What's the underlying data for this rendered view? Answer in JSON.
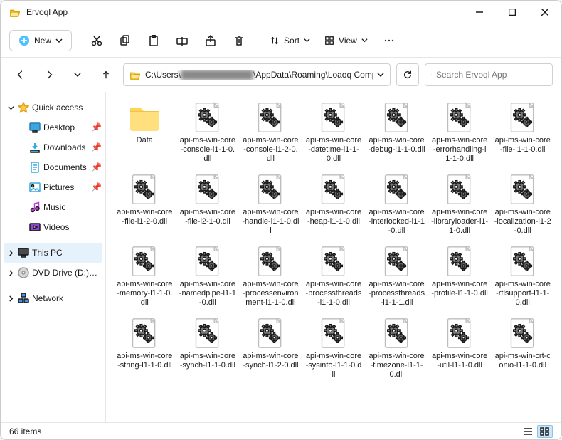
{
  "title": "Ervoql App",
  "toolbar": {
    "new": "New",
    "sort": "Sort",
    "view": "View"
  },
  "address": {
    "prefix": "C:\\Users\\",
    "blurred": "████████████",
    "suffix": "\\AppData\\Roaming\\Loaoq Comp Sols\\Ervoql App"
  },
  "search_placeholder": "Search Ervoql App",
  "sidebar": {
    "quick": "Quick access",
    "items": [
      "Desktop",
      "Downloads",
      "Documents",
      "Pictures",
      "Music",
      "Videos"
    ],
    "thispc": "This PC",
    "dvd": "DVD Drive (D:) CCCC",
    "network": "Network"
  },
  "files": [
    {
      "name": "Data",
      "type": "folder"
    },
    {
      "name": "api-ms-win-core-console-l1-1-0.dll",
      "type": "dll"
    },
    {
      "name": "api-ms-win-core-console-l1-2-0.dll",
      "type": "dll"
    },
    {
      "name": "api-ms-win-core-datetime-l1-1-0.dll",
      "type": "dll"
    },
    {
      "name": "api-ms-win-core-debug-l1-1-0.dll",
      "type": "dll"
    },
    {
      "name": "api-ms-win-core-errorhandling-l1-1-0.dll",
      "type": "dll"
    },
    {
      "name": "api-ms-win-core-file-l1-1-0.dll",
      "type": "dll"
    },
    {
      "name": "api-ms-win-core-file-l1-2-0.dll",
      "type": "dll"
    },
    {
      "name": "api-ms-win-core-file-l2-1-0.dll",
      "type": "dll"
    },
    {
      "name": "api-ms-win-core-handle-l1-1-0.dll",
      "type": "dll"
    },
    {
      "name": "api-ms-win-core-heap-l1-1-0.dll",
      "type": "dll"
    },
    {
      "name": "api-ms-win-core-interlocked-l1-1-0.dll",
      "type": "dll"
    },
    {
      "name": "api-ms-win-core-libraryloader-l1-1-0.dll",
      "type": "dll"
    },
    {
      "name": "api-ms-win-core-localization-l1-2-0.dll",
      "type": "dll"
    },
    {
      "name": "api-ms-win-core-memory-l1-1-0.dll",
      "type": "dll"
    },
    {
      "name": "api-ms-win-core-namedpipe-l1-1-0.dll",
      "type": "dll"
    },
    {
      "name": "api-ms-win-core-processenvironment-l1-1-0.dll",
      "type": "dll"
    },
    {
      "name": "api-ms-win-core-processthreads-l1-1-0.dll",
      "type": "dll"
    },
    {
      "name": "api-ms-win-core-processthreads-l1-1-1.dll",
      "type": "dll"
    },
    {
      "name": "api-ms-win-core-profile-l1-1-0.dll",
      "type": "dll"
    },
    {
      "name": "api-ms-win-core-rtlsupport-l1-1-0.dll",
      "type": "dll"
    },
    {
      "name": "api-ms-win-core-string-l1-1-0.dll",
      "type": "dll"
    },
    {
      "name": "api-ms-win-core-synch-l1-1-0.dll",
      "type": "dll"
    },
    {
      "name": "api-ms-win-core-synch-l1-2-0.dll",
      "type": "dll"
    },
    {
      "name": "api-ms-win-core-sysinfo-l1-1-0.dll",
      "type": "dll"
    },
    {
      "name": "api-ms-win-core-timezone-l1-1-0.dll",
      "type": "dll"
    },
    {
      "name": "api-ms-win-core-util-l1-1-0.dll",
      "type": "dll"
    },
    {
      "name": "api-ms-win-crt-conio-l1-1-0.dll",
      "type": "dll"
    }
  ],
  "status": "66 items"
}
